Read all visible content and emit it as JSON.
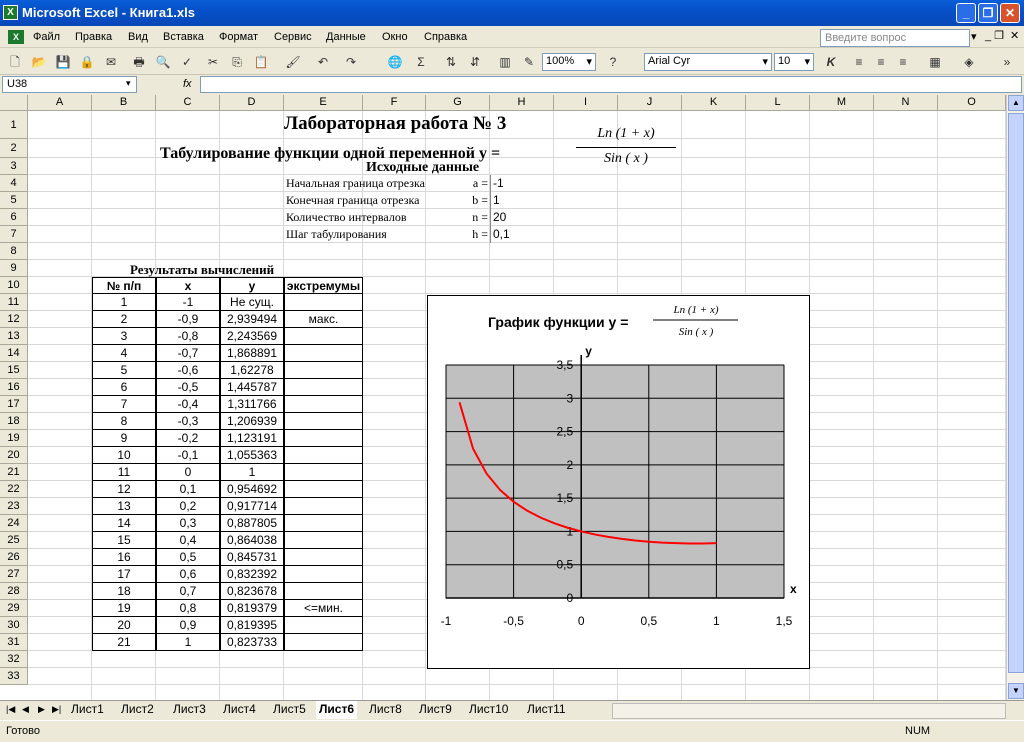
{
  "window": {
    "title": "Microsoft Excel - Книга1.xls"
  },
  "menu": [
    "Файл",
    "Правка",
    "Вид",
    "Вставка",
    "Формат",
    "Сервис",
    "Данные",
    "Окно",
    "Справка"
  ],
  "help_placeholder": "Введите вопрос",
  "toolbar": {
    "zoom": "100%",
    "font": "Arial Cyr",
    "size": "10"
  },
  "formula": {
    "namebox": "U38",
    "fx": "fx",
    "value": ""
  },
  "columns": [
    "A",
    "B",
    "C",
    "D",
    "E",
    "F",
    "G",
    "H",
    "I",
    "J",
    "K",
    "L",
    "M",
    "N",
    "O"
  ],
  "rows": [
    "1",
    "2",
    "3",
    "4",
    "5",
    "6",
    "7",
    "8",
    "9",
    "10",
    "11",
    "12",
    "13",
    "14",
    "15",
    "16",
    "17",
    "18",
    "19",
    "20",
    "21",
    "22",
    "23",
    "24",
    "25",
    "26",
    "27",
    "28",
    "29",
    "30",
    "31",
    "32",
    "33"
  ],
  "sheet": {
    "title1": "Лабораторная работа № 3",
    "title2": "Табулирование функции одной переменной y =",
    "frac_num": "Ln  (1 + x)",
    "frac_den": "Sin  ( x )",
    "initial_header": "Исходные данные",
    "params": [
      {
        "label": "Начальная граница отрезка",
        "var": "a =",
        "value": "-1"
      },
      {
        "label": "Конечная   граница отрезка",
        "var": "b =",
        "value": "1"
      },
      {
        "label": "Количество интервалов",
        "var": "n =",
        "value": "20"
      },
      {
        "label": "Шаг табулирования",
        "var": "h =",
        "value": "0,1"
      }
    ],
    "results_header": "Результаты вычислений",
    "table_headers": [
      "№ п/п",
      "x",
      "y",
      "экстремумы"
    ],
    "table_rows": [
      [
        "1",
        "-1",
        "Не сущ.",
        ""
      ],
      [
        "2",
        "-0,9",
        "2,939494",
        "макс."
      ],
      [
        "3",
        "-0,8",
        "2,243569",
        ""
      ],
      [
        "4",
        "-0,7",
        "1,868891",
        ""
      ],
      [
        "5",
        "-0,6",
        "1,62278",
        ""
      ],
      [
        "6",
        "-0,5",
        "1,445787",
        ""
      ],
      [
        "7",
        "-0,4",
        "1,311766",
        ""
      ],
      [
        "8",
        "-0,3",
        "1,206939",
        ""
      ],
      [
        "9",
        "-0,2",
        "1,123191",
        ""
      ],
      [
        "10",
        "-0,1",
        "1,055363",
        ""
      ],
      [
        "11",
        "0",
        "1",
        ""
      ],
      [
        "12",
        "0,1",
        "0,954692",
        ""
      ],
      [
        "13",
        "0,2",
        "0,917714",
        ""
      ],
      [
        "14",
        "0,3",
        "0,887805",
        ""
      ],
      [
        "15",
        "0,4",
        "0,864038",
        ""
      ],
      [
        "16",
        "0,5",
        "0,845731",
        ""
      ],
      [
        "17",
        "0,6",
        "0,832392",
        ""
      ],
      [
        "18",
        "0,7",
        "0,823678",
        ""
      ],
      [
        "19",
        "0,8",
        "0,819379",
        "<=мин."
      ],
      [
        "20",
        "0,9",
        "0,819395",
        ""
      ],
      [
        "21",
        "1",
        "0,823733",
        ""
      ]
    ]
  },
  "chart_data": {
    "type": "line",
    "title": "График функции y =",
    "title_frac_num": "Ln  (1 + x)",
    "title_frac_den": "Sin  ( x )",
    "xlabel": "x",
    "ylabel": "y",
    "xlim": [
      -1,
      1.5
    ],
    "ylim": [
      0,
      3.5
    ],
    "x_ticks": [
      "-1",
      "-0,5",
      "0",
      "0,5",
      "1",
      "1,5"
    ],
    "y_ticks": [
      "0",
      "0,5",
      "1",
      "1,5",
      "2",
      "2,5",
      "3",
      "3,5"
    ],
    "grid": true,
    "series": [
      {
        "color": "#ff0000",
        "x": [
          -0.9,
          -0.8,
          -0.7,
          -0.6,
          -0.5,
          -0.4,
          -0.3,
          -0.2,
          -0.1,
          0,
          0.1,
          0.2,
          0.3,
          0.4,
          0.5,
          0.6,
          0.7,
          0.8,
          0.9,
          1
        ],
        "y": [
          2.939494,
          2.243569,
          1.868891,
          1.62278,
          1.445787,
          1.311766,
          1.206939,
          1.123191,
          1.055363,
          1,
          0.954692,
          0.917714,
          0.887805,
          0.864038,
          0.845731,
          0.832392,
          0.823678,
          0.819379,
          0.819395,
          0.823733
        ]
      }
    ],
    "plot_bg": "#c0c0c0"
  },
  "tabs": [
    "Лист1",
    "Лист2",
    "Лист3",
    "Лист4",
    "Лист5",
    "Лист6",
    "Лист8",
    "Лист9",
    "Лист10",
    "Лист11"
  ],
  "active_tab": "Лист6",
  "status": {
    "ready": "Готово",
    "num": "NUM"
  }
}
